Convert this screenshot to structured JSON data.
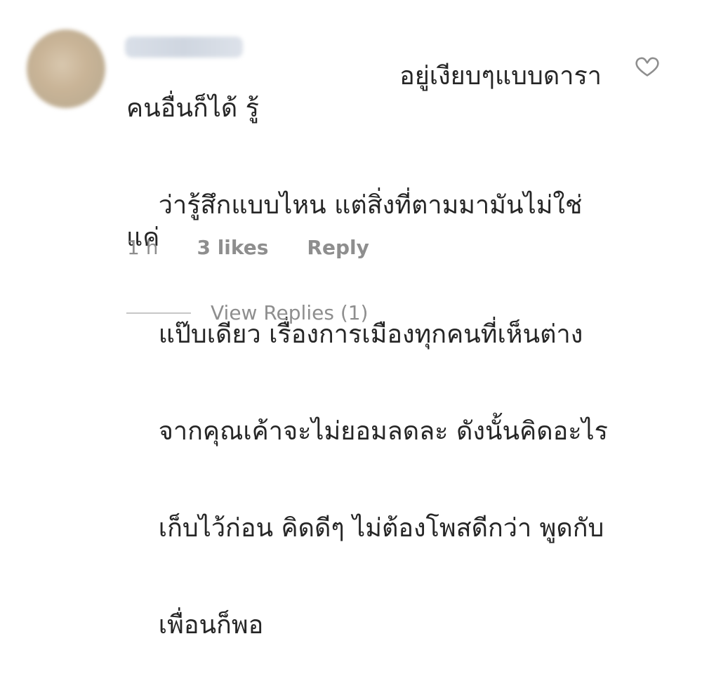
{
  "comment": {
    "avatar_icon": "user-avatar",
    "username": "",
    "text_lines": [
      "                              อยู่เงียบๆแบบดาราคนอื่นก็ได้ รู้",
      "ว่ารู้สึกแบบไหน แต่สิ่งที่ตามมามันไม่ใช่แค่",
      "แป๊บเดียว เรื่องการเมืองทุกคนที่เห็นต่าง",
      "จากคุณเค้าจะไม่ยอมลดละ ดังนั้นคิดอะไร",
      "เก็บไว้ก่อน คิดดีๆ ไม่ต้องโพสดีกว่า พูดกับ",
      "เพื่อนก็พอ"
    ],
    "time": "1 h",
    "likes": "3 likes",
    "reply_label": "Reply",
    "like_icon": "heart-outline-icon"
  },
  "replies": {
    "label": "View Replies (1)"
  }
}
